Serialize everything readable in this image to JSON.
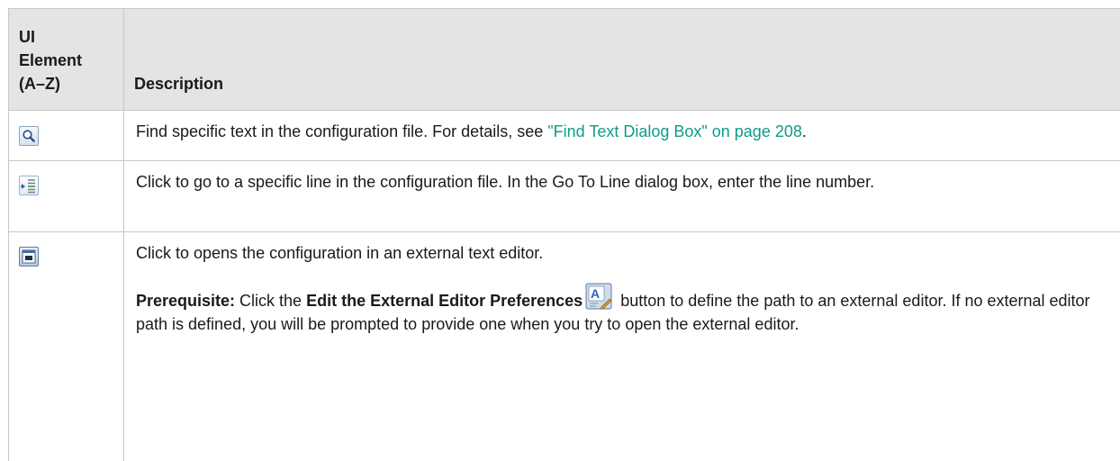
{
  "table": {
    "header": {
      "col1_line1": "UI",
      "col1_line2": "Element",
      "col1_line3": "(A–Z)",
      "col2": "Description"
    },
    "rows": [
      {
        "icon": "find-text-icon",
        "text": "Find specific text in the configuration file. For details, see ",
        "link": "\"Find Text Dialog Box\" on page 208",
        "text_after": "."
      },
      {
        "icon": "go-to-line-icon",
        "text": "Click to go to a specific line in the configuration file. In the Go To Line dialog box, enter the line number."
      },
      {
        "icon": "external-editor-icon",
        "text": "Click to opens the configuration in an external text editor.",
        "prereq_label": "Prerequisite:",
        "prereq_pre": " Click the ",
        "prereq_bold": "Edit the External Editor Preferences",
        "prereq_icon": "edit-external-editor-preferences-icon",
        "prereq_post": " button to define the path to an external editor. If no external editor path is defined, you will be prompted to provide one when you try to open the external editor."
      }
    ]
  },
  "colors": {
    "header_bg": "#e4e4e4",
    "border": "#c8c8c8",
    "link": "#0e9b89"
  }
}
